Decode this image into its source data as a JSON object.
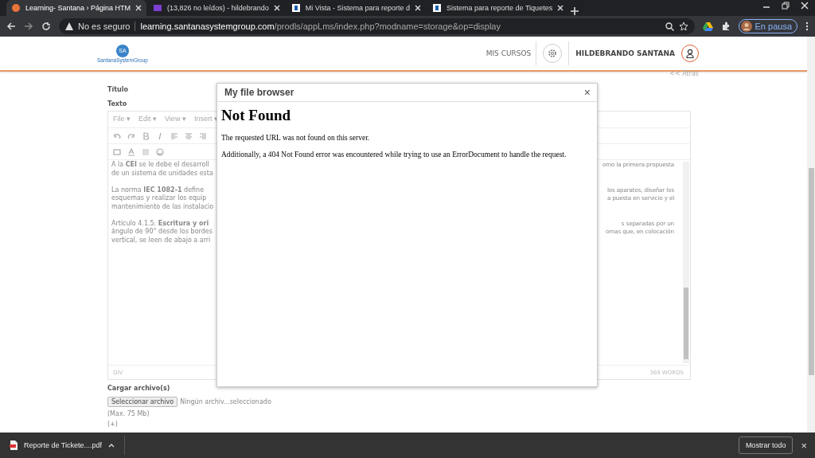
{
  "browser": {
    "tabs": [
      {
        "label": "Learning- Santana › Página HTM",
        "selected": true
      },
      {
        "label": "(13,826 no leídos) - hildebrando",
        "selected": false
      },
      {
        "label": "Mi Vista - Sistema para reporte d",
        "selected": false
      },
      {
        "label": "Sistema para reporte de Tiquetes",
        "selected": false
      }
    ],
    "security": "No es seguro",
    "url_host": "learning.santanasystemgroup.com",
    "url_path": "/prodls/appLms/index.php?modname=storage&op=display",
    "profile": "En pausa"
  },
  "header": {
    "logo_text": "SantanaSystemGroup",
    "logo_mark": "SA",
    "nav": "MIS CURSOS",
    "user": "HILDEBRANDO SANTANA",
    "back_link": "<< Atrás"
  },
  "form": {
    "title_label": "Título",
    "text_label": "Texto",
    "editor": {
      "menus": [
        "File ▾",
        "Edit ▾",
        "View ▾",
        "Insert ▾"
      ],
      "left_lines": [
        [
          "A la **CEI** se le debe el desarroll",
          "de un sistema de unidades esta"
        ],
        [
          "La norma **IEC 1082-1** define",
          "esquemas y realizar los equip",
          "mantenimiento de las instalacio"
        ],
        [
          "Artículo 4.1.5. **Escritura y ori**",
          "ángulo de 90° desde los bordes",
          "vertical, se leen de abajo a arri"
        ]
      ],
      "right_lines": [
        [
          "omo la primera propuesta"
        ],
        [
          "los aparatos, diseñar los",
          "a puesta en servicio y el"
        ],
        [
          "s separadas por un",
          "ornas que, en colocación"
        ]
      ],
      "path": "DIV",
      "word_count": "369 WORDS"
    },
    "upload_label": "Cargar archivo(s)",
    "file_button": "Seleccionar archivo",
    "file_status": "Ningún archiv...seleccionado",
    "max_size": "(Max. 75 Mb)",
    "more": "(+)"
  },
  "dialog": {
    "title": "My file browser",
    "close": "×",
    "heading": "Not Found",
    "paragraphs": [
      "The requested URL was not found on this server.",
      "Additionally, a 404 Not Found error was encountered while trying to use an ErrorDocument to handle the request."
    ]
  },
  "downloads": {
    "file": "Reporte de Tickete....pdf",
    "show_all": "Mostrar todo",
    "close": "×"
  }
}
